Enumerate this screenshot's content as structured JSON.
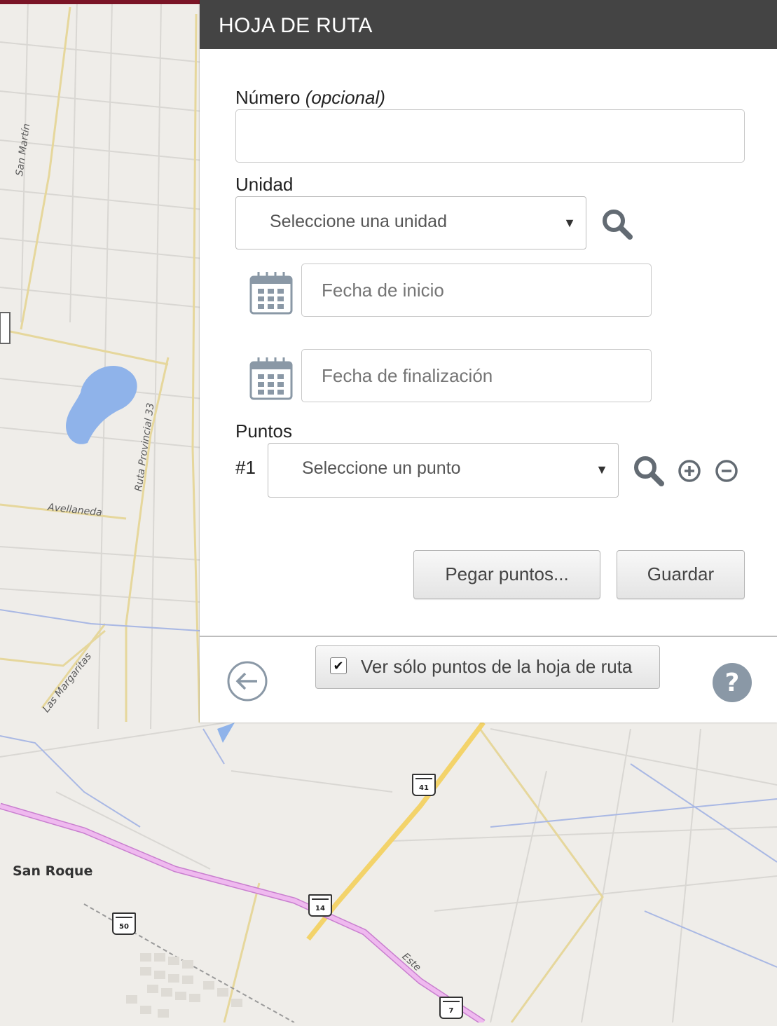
{
  "panel": {
    "title": "HOJA DE RUTA",
    "numero_label": "Número",
    "numero_optional": "(opcional)",
    "numero_value": "",
    "unidad_label": "Unidad",
    "unidad_select": "Seleccione una unidad",
    "fecha_inicio_placeholder": "Fecha de inicio",
    "fecha_fin_placeholder": "Fecha de finalización",
    "puntos_label": "Puntos",
    "punto_index": "#1",
    "punto_select": "Seleccione un punto",
    "pegar_button": "Pegar puntos...",
    "guardar_button": "Guardar",
    "ver_solo_label": "Ver sólo puntos de la hoja de ruta",
    "ver_solo_checked": true
  },
  "map": {
    "labels": {
      "san_martin": "San Martín",
      "ruta_33": "Ruta Provincial 33",
      "avellaneda": "Avellaneda",
      "las_margaritas": "Las Margaritas",
      "san_roque": "San Roque",
      "este": "Este"
    },
    "shields": {
      "r41": "41",
      "r14": "14",
      "r50": "50",
      "r7": "7"
    },
    "colors": {
      "water": "#8fb3ea",
      "highway": "#f3d36a",
      "motorway": "#e7a3e6",
      "road": "#e9d9a0",
      "boundary": "#a9b8e4"
    }
  }
}
